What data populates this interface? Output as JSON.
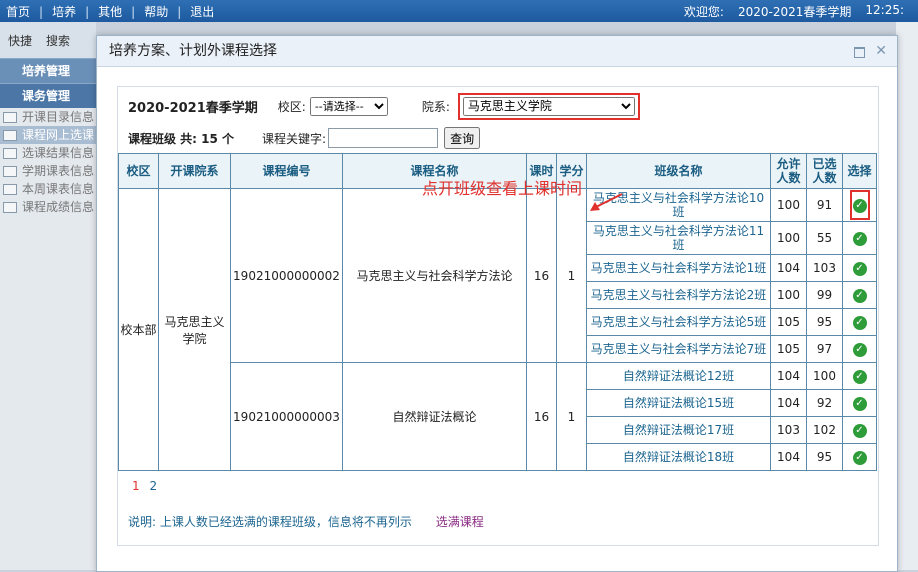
{
  "topbar": {
    "nav": [
      "首页",
      "培养",
      "其他",
      "帮助",
      "退出"
    ],
    "welcome": "欢迎您:",
    "term": "2020-2021春季学期",
    "time": "12:25:"
  },
  "sidebar": {
    "tabs": [
      "快捷",
      "搜索"
    ],
    "heads": [
      "培养管理",
      "课务管理"
    ],
    "items": [
      "开课目录信息",
      "课程网上选课",
      "选课结果信息",
      "学期课表信息",
      "本周课表信息",
      "课程成绩信息"
    ]
  },
  "modal": {
    "title": "培养方案、计划外课程选择",
    "term": "2020-2021春季学期",
    "campus_label": "校区:",
    "campus_value": "--请选择--",
    "dept_label": "院系:",
    "dept_value": "马克思主义学院",
    "count_label": "课程班级 共: 15 个",
    "keyword_label": "课程关键字:",
    "keyword_value": "",
    "query_button": "查询",
    "annotation": "点开班级查看上课时间",
    "headers": {
      "campus": "校区",
      "school": "开课院系",
      "code": "课程编号",
      "name": "课程名称",
      "hours": "课时",
      "credit": "学分",
      "class": "班级名称",
      "allow": "允许人数",
      "chosen": "已选人数",
      "select": "选择"
    },
    "campus_cell": "校本部",
    "school_cell": "马克思主义学院",
    "courses": [
      {
        "code": "19021000000002",
        "name": "马克思主义与社会科学方法论",
        "hours": "16",
        "credit": "1",
        "classes": [
          {
            "name": "马克思主义与社会科学方法论10班",
            "allow": "100",
            "chosen": "91"
          },
          {
            "name": "马克思主义与社会科学方法论11班",
            "allow": "100",
            "chosen": "55"
          },
          {
            "name": "马克思主义与社会科学方法论1班",
            "allow": "104",
            "chosen": "103"
          },
          {
            "name": "马克思主义与社会科学方法论2班",
            "allow": "100",
            "chosen": "99"
          },
          {
            "name": "马克思主义与社会科学方法论5班",
            "allow": "105",
            "chosen": "95"
          },
          {
            "name": "马克思主义与社会科学方法论7班",
            "allow": "105",
            "chosen": "97"
          }
        ]
      },
      {
        "code": "19021000000003",
        "name": "自然辩证法概论",
        "hours": "16",
        "credit": "1",
        "classes": [
          {
            "name": "自然辩证法概论12班",
            "allow": "104",
            "chosen": "100"
          },
          {
            "name": "自然辩证法概论15班",
            "allow": "104",
            "chosen": "92"
          },
          {
            "name": "自然辩证法概论17班",
            "allow": "103",
            "chosen": "102"
          },
          {
            "name": "自然辩证法概论18班",
            "allow": "104",
            "chosen": "95"
          }
        ]
      }
    ],
    "pages": [
      "1",
      "2"
    ],
    "note": "说明: 上课人数已经选满的课程班级，信息将不再列示",
    "full_link": "选满课程"
  },
  "colors": {
    "accent": "#1d5aa0",
    "highlight": "#e0312d",
    "ok": "#2e9c39"
  }
}
